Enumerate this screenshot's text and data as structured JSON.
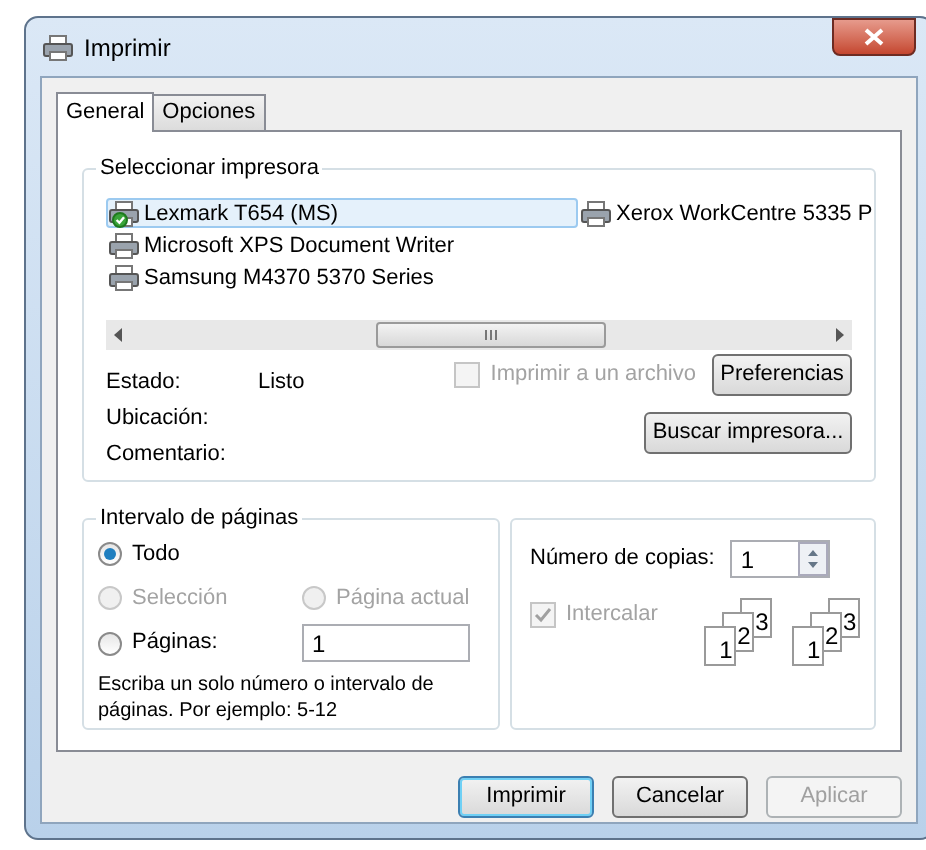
{
  "window": {
    "title": "Imprimir"
  },
  "tabs": [
    {
      "label": "General",
      "selected": true
    },
    {
      "label": "Opciones",
      "selected": false
    }
  ],
  "printer_group": {
    "title": "Seleccionar impresora",
    "printers": [
      {
        "name": "Lexmark T654 (MS)",
        "selected": true,
        "default": true
      },
      {
        "name": "Microsoft XPS Document Writer",
        "selected": false,
        "default": false
      },
      {
        "name": "Samsung M4370 5370 Series",
        "selected": false,
        "default": false
      },
      {
        "name": "Xerox WorkCentre 5335 P",
        "selected": false,
        "default": false
      }
    ],
    "status": [
      {
        "label": "Estado:",
        "value": "Listo"
      },
      {
        "label": "Ubicación:"
      },
      {
        "label": "Comentario:"
      }
    ],
    "print_to_file": {
      "label": "Imprimir a un archivo",
      "checked": false,
      "disabled": true
    },
    "buttons": [
      "Preferencias",
      "Buscar impresora..."
    ]
  },
  "page_range": {
    "title": "Intervalo de páginas",
    "options": [
      {
        "label": "Todo",
        "selected": true,
        "disabled": false
      },
      {
        "label": "Selección",
        "selected": false,
        "disabled": true
      },
      {
        "label": "Página actual",
        "selected": false,
        "disabled": true
      },
      {
        "label": "Páginas:",
        "selected": false,
        "disabled": false
      }
    ],
    "pages_value": "1",
    "hint": "Escriba un solo número o intervalo de páginas. Por ejemplo: 5-12"
  },
  "copies": {
    "label": "Número de copias:",
    "value": "1",
    "collate": {
      "label": "Intercalar",
      "checked": true,
      "disabled": true
    },
    "collate_sets": [
      [
        "1",
        "2",
        "3"
      ],
      [
        "1",
        "2",
        "3"
      ]
    ]
  },
  "footer_buttons": [
    {
      "label": "Imprimir",
      "disabled": false,
      "default": true
    },
    {
      "label": "Cancelar",
      "disabled": false,
      "default": false
    },
    {
      "label": "Aplicar",
      "disabled": true,
      "default": false
    }
  ]
}
